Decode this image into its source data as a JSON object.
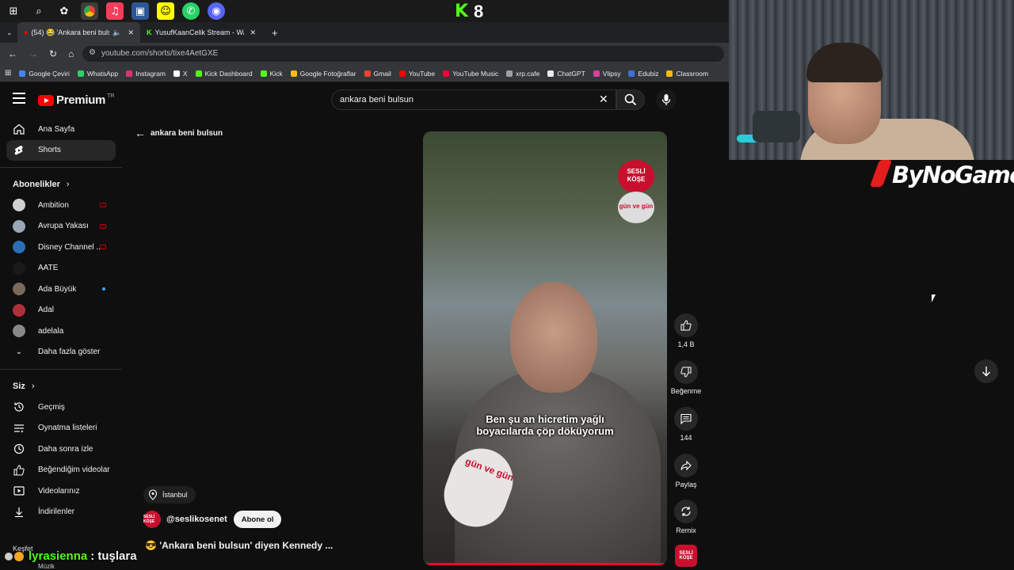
{
  "kick_count": "8",
  "browser": {
    "tabs": [
      {
        "label": "(54) 😂 'Ankara beni bulsu",
        "active": true
      },
      {
        "label": "YusufKaanCelik Stream - Watch",
        "active": false
      }
    ],
    "new_tab": "+",
    "url": "youtube.com/shorts/tixe4AetGXE"
  },
  "bookmarks": [
    {
      "label": "Google Çeviri",
      "color": "#4285f4"
    },
    {
      "label": "WhatsApp",
      "color": "#25d366"
    },
    {
      "label": "Instagram",
      "color": "#e1306c"
    },
    {
      "label": "X",
      "color": "#ffffff"
    },
    {
      "label": "Kick Dashboard",
      "color": "#53fc18"
    },
    {
      "label": "Kick",
      "color": "#53fc18"
    },
    {
      "label": "Google Fotoğraflar",
      "color": "#fbbc04"
    },
    {
      "label": "Gmail",
      "color": "#ea4335"
    },
    {
      "label": "YouTube",
      "color": "#ff0000"
    },
    {
      "label": "YouTube Music",
      "color": "#ff0033"
    },
    {
      "label": "xrp.cafe",
      "color": "#9aa0a6"
    },
    {
      "label": "ChatGPT",
      "color": "#e8eaed"
    },
    {
      "label": "Vlipsy",
      "color": "#d93fa0"
    },
    {
      "label": "Edubiz",
      "color": "#3f6fd9"
    },
    {
      "label": "Classroom",
      "color": "#fbbc04"
    }
  ],
  "youtube": {
    "brand": "Premium",
    "region": "TR",
    "search_query": "ankara beni bulsun",
    "back_label": "ankara beni bulsun"
  },
  "sidebar": {
    "main": [
      {
        "label": "Ana Sayfa",
        "icon": "home-icon"
      },
      {
        "label": "Shorts",
        "icon": "shorts-icon",
        "active": true
      }
    ],
    "subs_header": "Abonelikler",
    "subscriptions": [
      {
        "label": "Ambition",
        "color": "#d0d0d0",
        "live": true
      },
      {
        "label": "Avrupa Yakası",
        "color": "#9aa7b8",
        "live": true
      },
      {
        "label": "Disney Channel ...",
        "color": "#2b6fb6",
        "live": true
      },
      {
        "label": "AATE",
        "color": "#1a1a1a"
      },
      {
        "label": "Ada Büyük",
        "color": "#7a6a5a",
        "new": true
      },
      {
        "label": "Adal",
        "color": "#b0303a"
      },
      {
        "label": "adelala",
        "color": "#888888"
      }
    ],
    "show_more": "Daha fazla göster",
    "you_header": "Siz",
    "you_items": [
      {
        "label": "Geçmiş",
        "icon": "history-icon"
      },
      {
        "label": "Oynatma listeleri",
        "icon": "playlists-icon"
      },
      {
        "label": "Daha sonra izle",
        "icon": "clock-icon"
      },
      {
        "label": "Beğendiğim videolar",
        "icon": "like-icon"
      },
      {
        "label": "Videolarınız",
        "icon": "videos-icon"
      },
      {
        "label": "İndirilenler",
        "icon": "download-icon"
      }
    ],
    "explore": "Keşfet",
    "music": "Müzik"
  },
  "video": {
    "caption_line1": "Ben şu an hicretim yağlı",
    "caption_line2": "boyacılarda çöp döküyorum",
    "badge_top": "SESLİ KÖŞE",
    "badge_bottom": "gün ve gün",
    "mic_text": "gün ve gün",
    "location": "İstanbul",
    "channel": "@seslikosenet",
    "channel_avatar": "SESLİ KÖŞE",
    "subscribe": "Abone ol",
    "title": "😎 'Ankara beni bulsun' diyen Kennedy ..."
  },
  "actions": {
    "like_count": "1,4 B",
    "dislike_label": "Beğenme",
    "comment_count": "144",
    "share_label": "Paylaş",
    "remix_label": "Remix"
  },
  "chat": {
    "user": "lyrasienna",
    "message": ": tuşlara"
  },
  "stream": {
    "brand": "ByNoGame"
  }
}
